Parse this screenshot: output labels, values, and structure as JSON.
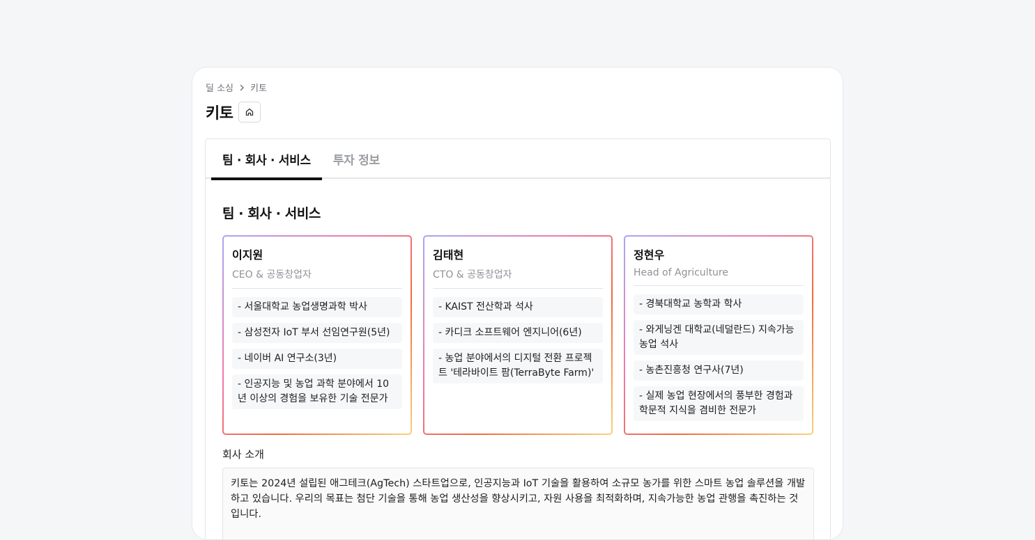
{
  "breadcrumb": {
    "parent": "딜 소싱",
    "current": "키토"
  },
  "page": {
    "title": "키토"
  },
  "tabs": [
    {
      "label": "팀 · 회사 · 서비스",
      "active": true
    },
    {
      "label": "투자 정보",
      "active": false
    }
  ],
  "section": {
    "title": "팀 · 회사 · 서비스"
  },
  "members": [
    {
      "name": "이지원",
      "role": "CEO & 공동창업자",
      "items": [
        "- 서울대학교 농업생명과학 박사",
        "- 삼성전자 IoT 부서 선임연구원(5년)",
        "- 네이버 AI 연구소(3년)",
        "- 인공지능 및 농업 과학 분야에서 10년 이상의 경험을 보유한 기술 전문가"
      ]
    },
    {
      "name": "김태현",
      "role": "CTO & 공동창업자",
      "items": [
        "- KAIST 전산학과 석사",
        "- 카디크 소프트웨어 엔지니어(6년)",
        "- 농업 분야에서의 디지털 전환 프로젝트 '테라바이트 팜(TerraByte Farm)'"
      ]
    },
    {
      "name": "정현우",
      "role": "Head of Agriculture",
      "items": [
        "- 경북대학교 농학과 학사",
        "- 와게닝겐 대학교(네덜란드) 지속가능농업 석사",
        "- 농촌진흥청 연구사(7년)",
        "- 실제 농업 현장에서의 풍부한 경험과 학문적 지식을 겸비한 전문가"
      ]
    }
  ],
  "company": {
    "label": "회사 소개",
    "text": "키토는 2024년 설립된 애그테크(AgTech) 스타트업으로, 인공지능과 IoT 기술을 활용하여 소규모 농가를 위한 스마트 농업 솔루션을 개발하고 있습니다. 우리의 목표는 첨단 기술을 통해 농업 생산성을 향상시키고, 자원 사용을 최적화하며, 지속가능한 농업 관행을 촉진하는 것입니다."
  },
  "icons": {
    "breadcrumb_separator": "chevron-right-icon",
    "home": "home-icon"
  }
}
